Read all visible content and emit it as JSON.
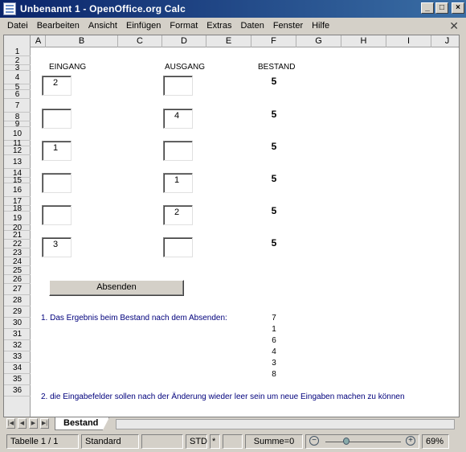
{
  "window": {
    "title": "Unbenannt 1 - OpenOffice.org Calc"
  },
  "menu": [
    "Datei",
    "Bearbeiten",
    "Ansicht",
    "Einfügen",
    "Format",
    "Extras",
    "Daten",
    "Fenster",
    "Hilfe"
  ],
  "columns": [
    "A",
    "B",
    "C",
    "D",
    "E",
    "F",
    "G",
    "H",
    "I",
    "J"
  ],
  "rows": [
    "1",
    "2",
    "3",
    "4",
    "5",
    "6",
    "7",
    "8",
    "9",
    "10",
    "11",
    "12",
    "13",
    "14",
    "15",
    "16",
    "17",
    "18",
    "19",
    "20",
    "21",
    "22",
    "23",
    "24",
    "25",
    "26",
    "27",
    "28",
    "29",
    "30",
    "31",
    "32",
    "33",
    "34",
    "35",
    "36"
  ],
  "sheet": {
    "label_eingang": "EINGANG",
    "label_ausgang": "AUSGANG",
    "label_bestand": "BESTAND",
    "eingang": [
      "2",
      "",
      "1",
      "",
      "",
      "3"
    ],
    "ausgang": [
      "",
      "4",
      "",
      "1",
      "2",
      ""
    ],
    "bestand": [
      "5",
      "5",
      "5",
      "5",
      "5",
      "5"
    ],
    "button_label": "Absenden",
    "note1": "1. Das Ergebnis beim Bestand nach dem Absenden:",
    "results": [
      "7",
      "1",
      "6",
      "4",
      "3",
      "8"
    ],
    "note2": "2. die Eingabefelder sollen nach der Änderung  wieder leer sein um neue Eingaben machen zu können"
  },
  "tabs": {
    "active": "Bestand"
  },
  "status": {
    "sheet": "Tabelle 1 / 1",
    "style": "Standard",
    "mode": "STD",
    "modified": "*",
    "sum": "Summe=0",
    "zoom": "69%"
  }
}
